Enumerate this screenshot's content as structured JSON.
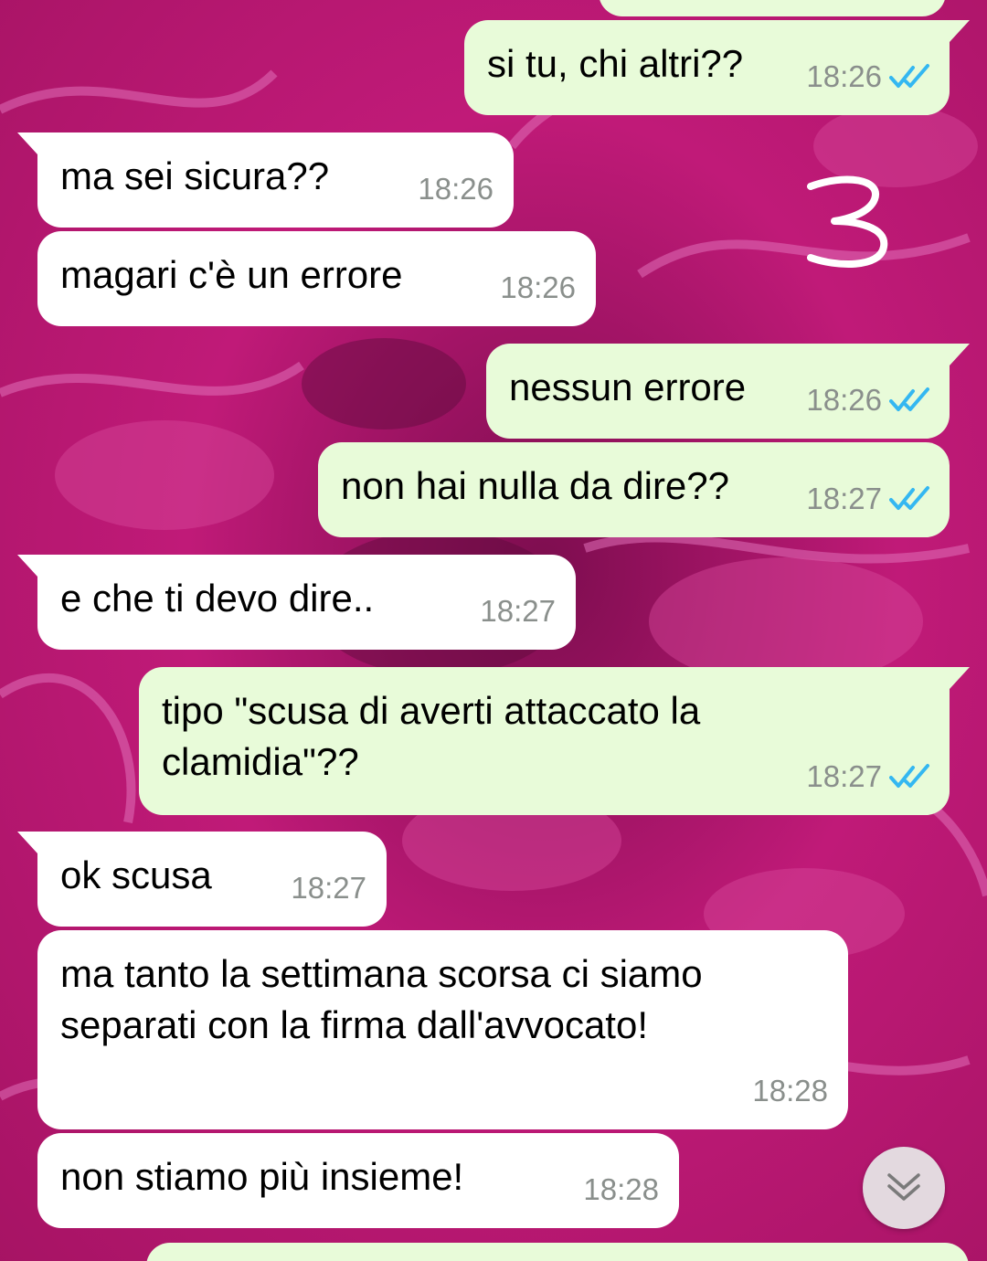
{
  "chat": {
    "messages": [
      {
        "direction": "out",
        "text": "si tu, chi altri??",
        "time": "18:26",
        "status": "read"
      },
      {
        "direction": "in",
        "text": "ma sei sicura??",
        "time": "18:26"
      },
      {
        "direction": "in",
        "text": "magari c'è un errore",
        "time": "18:26"
      },
      {
        "direction": "out",
        "text": "nessun errore",
        "time": "18:26",
        "status": "read"
      },
      {
        "direction": "out",
        "text": "non hai nulla da dire??",
        "time": "18:27",
        "status": "read"
      },
      {
        "direction": "in",
        "text": "e che ti devo dire..",
        "time": "18:27"
      },
      {
        "direction": "out",
        "text": "tipo \"scusa di averti attaccato la clamidia\"??",
        "time": "18:27",
        "status": "read"
      },
      {
        "direction": "in",
        "text": "ok scusa",
        "time": "18:27"
      },
      {
        "direction": "in",
        "text": "ma tanto la settimana scorsa ci siamo separati con la firma dall'avvocato!",
        "time": "18:28"
      },
      {
        "direction": "in",
        "text": "non stiamo più insieme!",
        "time": "18:28"
      }
    ]
  },
  "annotation": {
    "label": "3"
  },
  "colors": {
    "incoming_bubble": "#ffffff",
    "outgoing_bubble": "#e8fbd9",
    "read_ticks": "#34b7f1",
    "timestamp": "#8a8f8c"
  },
  "icons": {
    "read_receipt": "double-check-icon",
    "scroll_down": "double-chevron-down-icon"
  }
}
